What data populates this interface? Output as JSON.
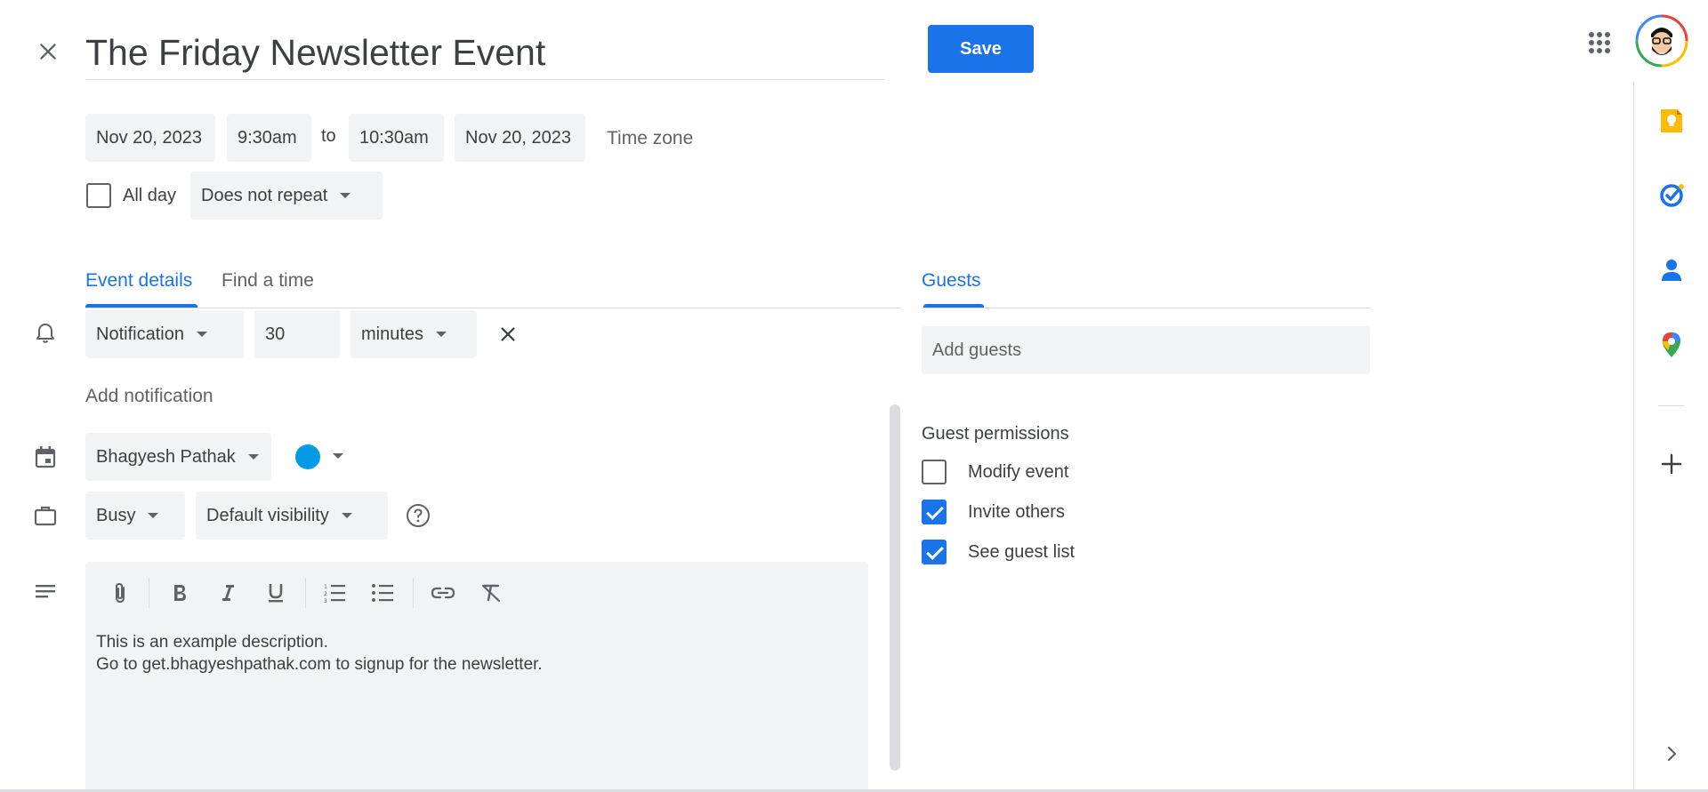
{
  "header": {
    "title": "The Friday Newsletter Event",
    "save_label": "Save"
  },
  "date_row": {
    "start_date": "Nov 20, 2023",
    "start_time": "9:30am",
    "to_label": "to",
    "end_time": "10:30am",
    "end_date": "Nov 20, 2023",
    "timezone_label": "Time zone"
  },
  "options_row": {
    "all_day_label": "All day",
    "all_day_checked": false,
    "repeat_value": "Does not repeat"
  },
  "tabs": {
    "event_details": "Event details",
    "find_a_time": "Find a time",
    "guests": "Guests"
  },
  "notification": {
    "type": "Notification",
    "amount": "30",
    "unit": "minutes",
    "add_label": "Add notification"
  },
  "calendar": {
    "owner": "Bhagyesh Pathak",
    "color": "#039be5"
  },
  "availability": {
    "status": "Busy",
    "visibility": "Default visibility"
  },
  "description": {
    "line1": "This is an example description.",
    "line2": "Go to get.bhagyeshpathak.com to signup for the newsletter."
  },
  "guests": {
    "add_placeholder": "Add guests",
    "permissions_title": "Guest permissions",
    "permissions": [
      {
        "label": "Modify event",
        "checked": false
      },
      {
        "label": "Invite others",
        "checked": true
      },
      {
        "label": "See guest list",
        "checked": true
      }
    ]
  },
  "colors": {
    "accent": "#1a73e8",
    "field_bg": "#f1f3f4",
    "text": "#3c4043",
    "muted": "#5f6368"
  },
  "side_panel_icons": [
    "keep-icon",
    "tasks-icon",
    "contacts-icon",
    "maps-icon",
    "add-icon",
    "chevron-right-icon"
  ]
}
